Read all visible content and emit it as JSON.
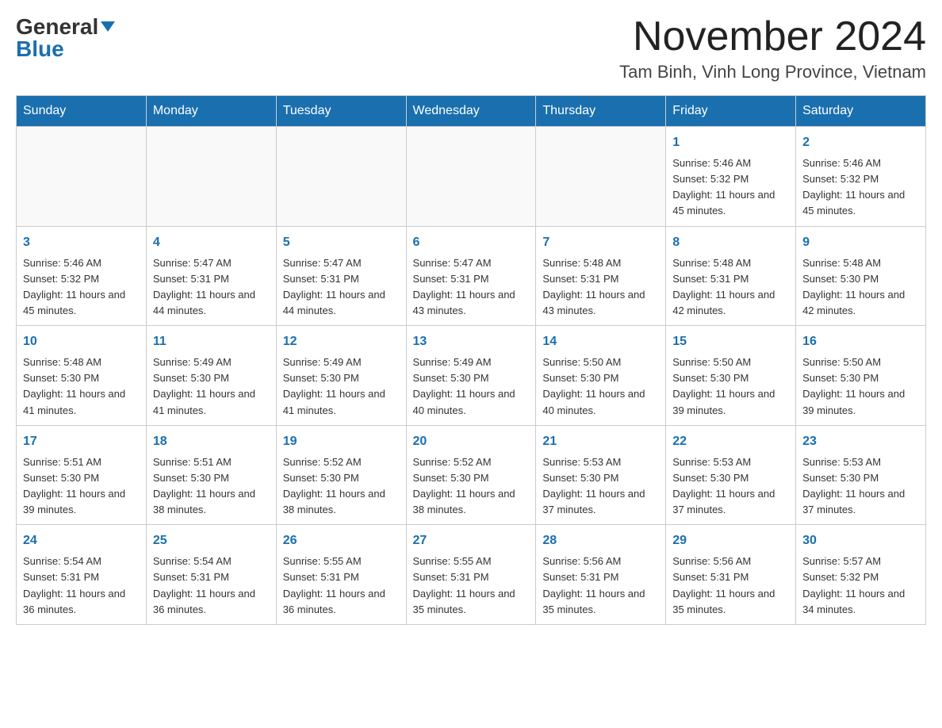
{
  "header": {
    "logo_general": "General",
    "logo_blue": "Blue",
    "month_title": "November 2024",
    "location": "Tam Binh, Vinh Long Province, Vietnam"
  },
  "weekdays": [
    "Sunday",
    "Monday",
    "Tuesday",
    "Wednesday",
    "Thursday",
    "Friday",
    "Saturday"
  ],
  "weeks": [
    [
      {
        "day": "",
        "info": ""
      },
      {
        "day": "",
        "info": ""
      },
      {
        "day": "",
        "info": ""
      },
      {
        "day": "",
        "info": ""
      },
      {
        "day": "",
        "info": ""
      },
      {
        "day": "1",
        "info": "Sunrise: 5:46 AM\nSunset: 5:32 PM\nDaylight: 11 hours and 45 minutes."
      },
      {
        "day": "2",
        "info": "Sunrise: 5:46 AM\nSunset: 5:32 PM\nDaylight: 11 hours and 45 minutes."
      }
    ],
    [
      {
        "day": "3",
        "info": "Sunrise: 5:46 AM\nSunset: 5:32 PM\nDaylight: 11 hours and 45 minutes."
      },
      {
        "day": "4",
        "info": "Sunrise: 5:47 AM\nSunset: 5:31 PM\nDaylight: 11 hours and 44 minutes."
      },
      {
        "day": "5",
        "info": "Sunrise: 5:47 AM\nSunset: 5:31 PM\nDaylight: 11 hours and 44 minutes."
      },
      {
        "day": "6",
        "info": "Sunrise: 5:47 AM\nSunset: 5:31 PM\nDaylight: 11 hours and 43 minutes."
      },
      {
        "day": "7",
        "info": "Sunrise: 5:48 AM\nSunset: 5:31 PM\nDaylight: 11 hours and 43 minutes."
      },
      {
        "day": "8",
        "info": "Sunrise: 5:48 AM\nSunset: 5:31 PM\nDaylight: 11 hours and 42 minutes."
      },
      {
        "day": "9",
        "info": "Sunrise: 5:48 AM\nSunset: 5:30 PM\nDaylight: 11 hours and 42 minutes."
      }
    ],
    [
      {
        "day": "10",
        "info": "Sunrise: 5:48 AM\nSunset: 5:30 PM\nDaylight: 11 hours and 41 minutes."
      },
      {
        "day": "11",
        "info": "Sunrise: 5:49 AM\nSunset: 5:30 PM\nDaylight: 11 hours and 41 minutes."
      },
      {
        "day": "12",
        "info": "Sunrise: 5:49 AM\nSunset: 5:30 PM\nDaylight: 11 hours and 41 minutes."
      },
      {
        "day": "13",
        "info": "Sunrise: 5:49 AM\nSunset: 5:30 PM\nDaylight: 11 hours and 40 minutes."
      },
      {
        "day": "14",
        "info": "Sunrise: 5:50 AM\nSunset: 5:30 PM\nDaylight: 11 hours and 40 minutes."
      },
      {
        "day": "15",
        "info": "Sunrise: 5:50 AM\nSunset: 5:30 PM\nDaylight: 11 hours and 39 minutes."
      },
      {
        "day": "16",
        "info": "Sunrise: 5:50 AM\nSunset: 5:30 PM\nDaylight: 11 hours and 39 minutes."
      }
    ],
    [
      {
        "day": "17",
        "info": "Sunrise: 5:51 AM\nSunset: 5:30 PM\nDaylight: 11 hours and 39 minutes."
      },
      {
        "day": "18",
        "info": "Sunrise: 5:51 AM\nSunset: 5:30 PM\nDaylight: 11 hours and 38 minutes."
      },
      {
        "day": "19",
        "info": "Sunrise: 5:52 AM\nSunset: 5:30 PM\nDaylight: 11 hours and 38 minutes."
      },
      {
        "day": "20",
        "info": "Sunrise: 5:52 AM\nSunset: 5:30 PM\nDaylight: 11 hours and 38 minutes."
      },
      {
        "day": "21",
        "info": "Sunrise: 5:53 AM\nSunset: 5:30 PM\nDaylight: 11 hours and 37 minutes."
      },
      {
        "day": "22",
        "info": "Sunrise: 5:53 AM\nSunset: 5:30 PM\nDaylight: 11 hours and 37 minutes."
      },
      {
        "day": "23",
        "info": "Sunrise: 5:53 AM\nSunset: 5:30 PM\nDaylight: 11 hours and 37 minutes."
      }
    ],
    [
      {
        "day": "24",
        "info": "Sunrise: 5:54 AM\nSunset: 5:31 PM\nDaylight: 11 hours and 36 minutes."
      },
      {
        "day": "25",
        "info": "Sunrise: 5:54 AM\nSunset: 5:31 PM\nDaylight: 11 hours and 36 minutes."
      },
      {
        "day": "26",
        "info": "Sunrise: 5:55 AM\nSunset: 5:31 PM\nDaylight: 11 hours and 36 minutes."
      },
      {
        "day": "27",
        "info": "Sunrise: 5:55 AM\nSunset: 5:31 PM\nDaylight: 11 hours and 35 minutes."
      },
      {
        "day": "28",
        "info": "Sunrise: 5:56 AM\nSunset: 5:31 PM\nDaylight: 11 hours and 35 minutes."
      },
      {
        "day": "29",
        "info": "Sunrise: 5:56 AM\nSunset: 5:31 PM\nDaylight: 11 hours and 35 minutes."
      },
      {
        "day": "30",
        "info": "Sunrise: 5:57 AM\nSunset: 5:32 PM\nDaylight: 11 hours and 34 minutes."
      }
    ]
  ]
}
